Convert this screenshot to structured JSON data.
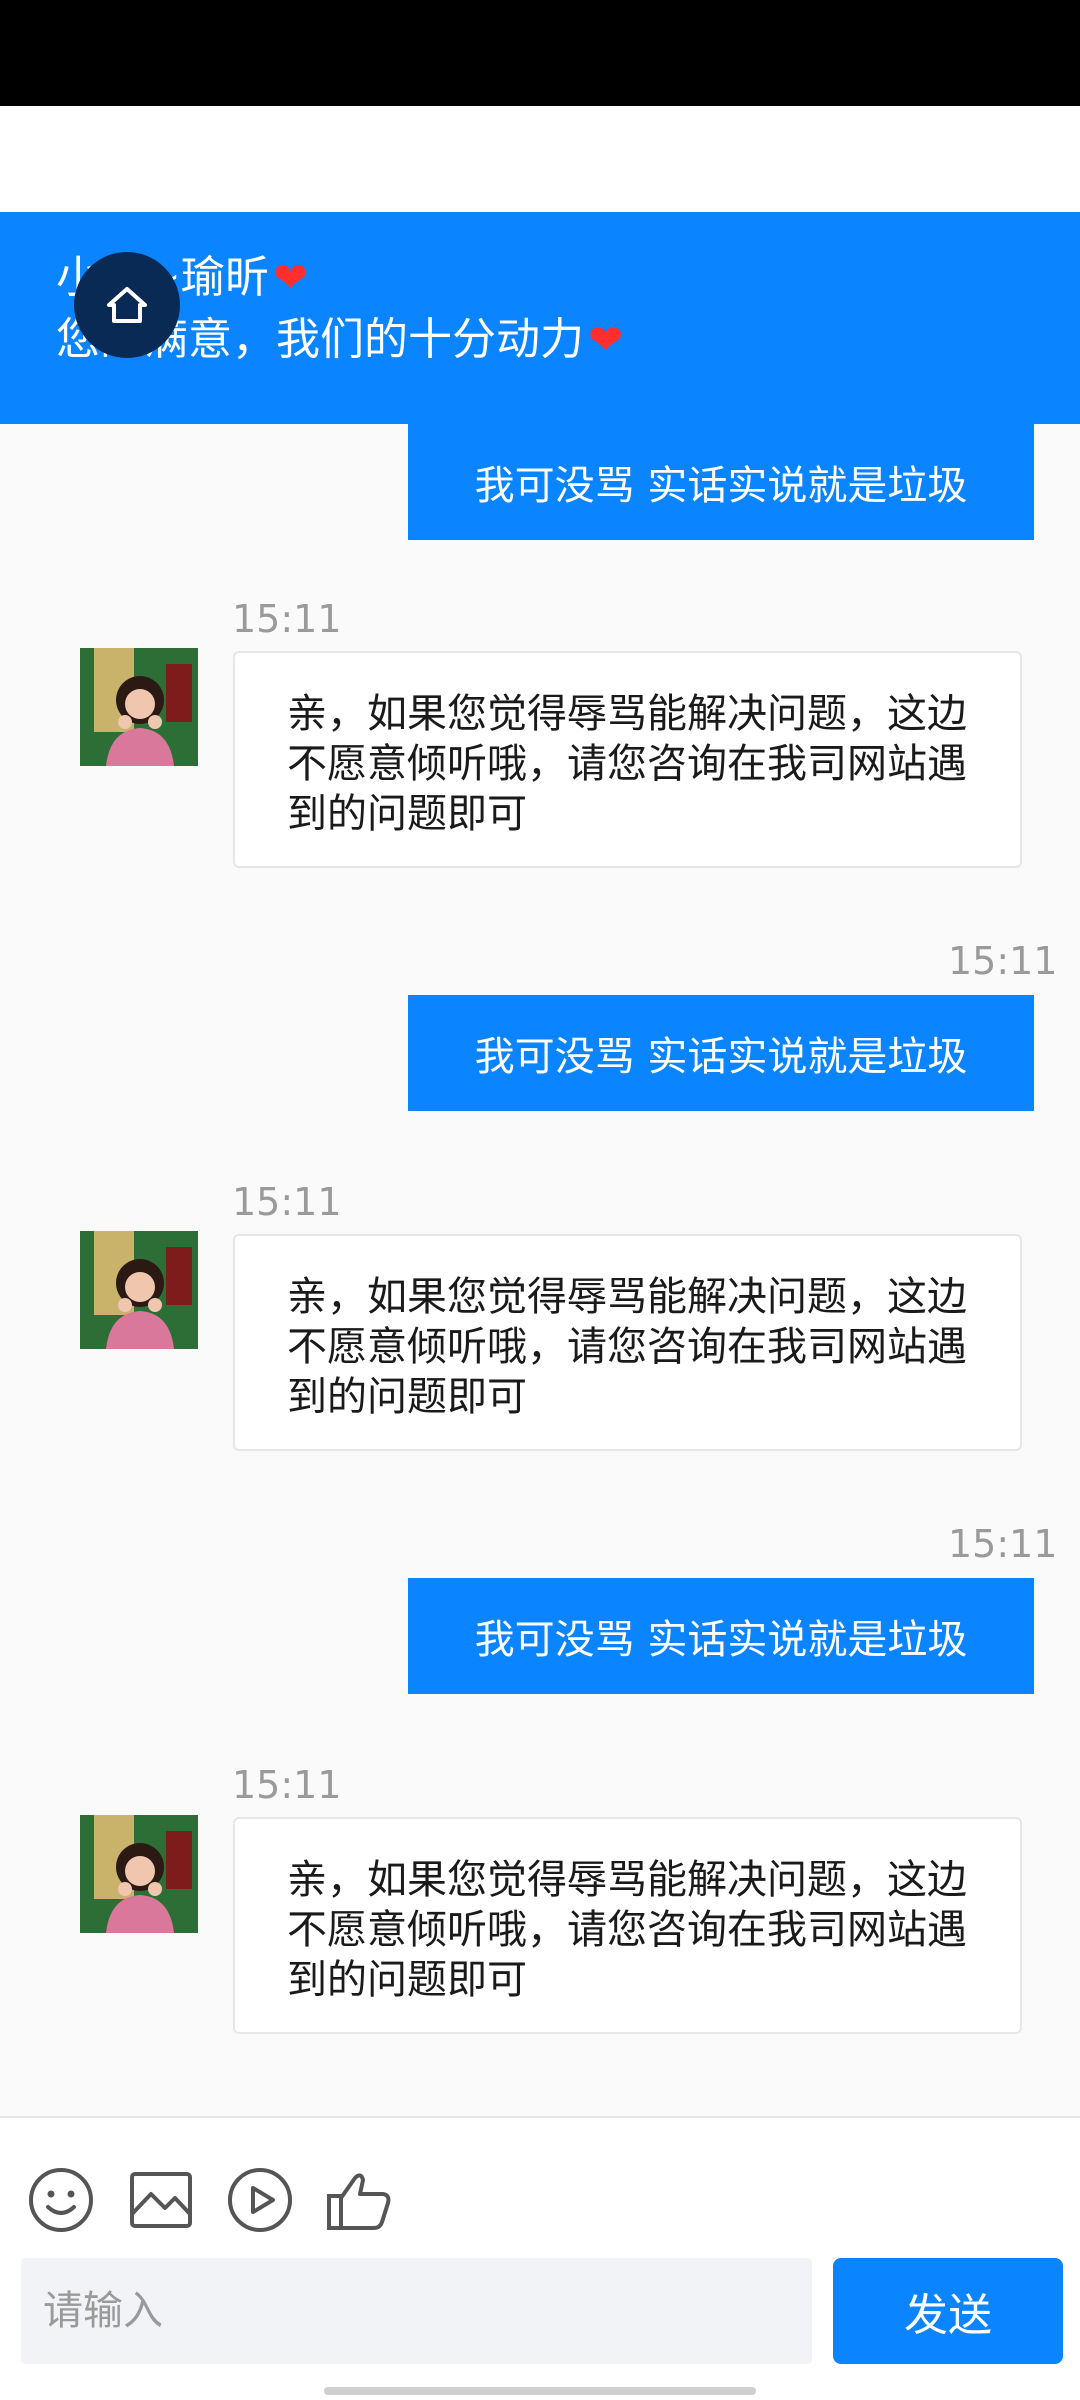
{
  "header": {
    "line1": "小象~瑜昕",
    "line2": "您的满意，我们的十分动力",
    "heart": "❤"
  },
  "messages": [
    {
      "direction": "out",
      "text": "我可没骂 实话实说就是垃圾"
    },
    {
      "direction": "in",
      "time": "15:11",
      "text": "亲，如果您觉得辱骂能解决问题，这边不愿意倾听哦，请您咨询在我司网站遇到的问题即可"
    },
    {
      "direction": "out",
      "time": "15:11",
      "text": "我可没骂 实话实说就是垃圾"
    },
    {
      "direction": "in",
      "time": "15:11",
      "text": "亲，如果您觉得辱骂能解决问题，这边不愿意倾听哦，请您咨询在我司网站遇到的问题即可"
    },
    {
      "direction": "out",
      "time": "15:11",
      "text": "我可没骂 实话实说就是垃圾"
    },
    {
      "direction": "in",
      "time": "15:11",
      "text": "亲，如果您觉得辱骂能解决问题，这边不愿意倾听哦，请您咨询在我司网站遇到的问题即可"
    }
  ],
  "toolbar": {
    "icons": [
      "emoji-icon",
      "image-icon",
      "video-icon",
      "thumbs-up-icon"
    ]
  },
  "input": {
    "placeholder": "请输入",
    "value": ""
  },
  "send_label": "发送",
  "colors": {
    "accent": "#0a84ff",
    "home_button": "#0a2a56",
    "heart": "#ff2f2f"
  }
}
